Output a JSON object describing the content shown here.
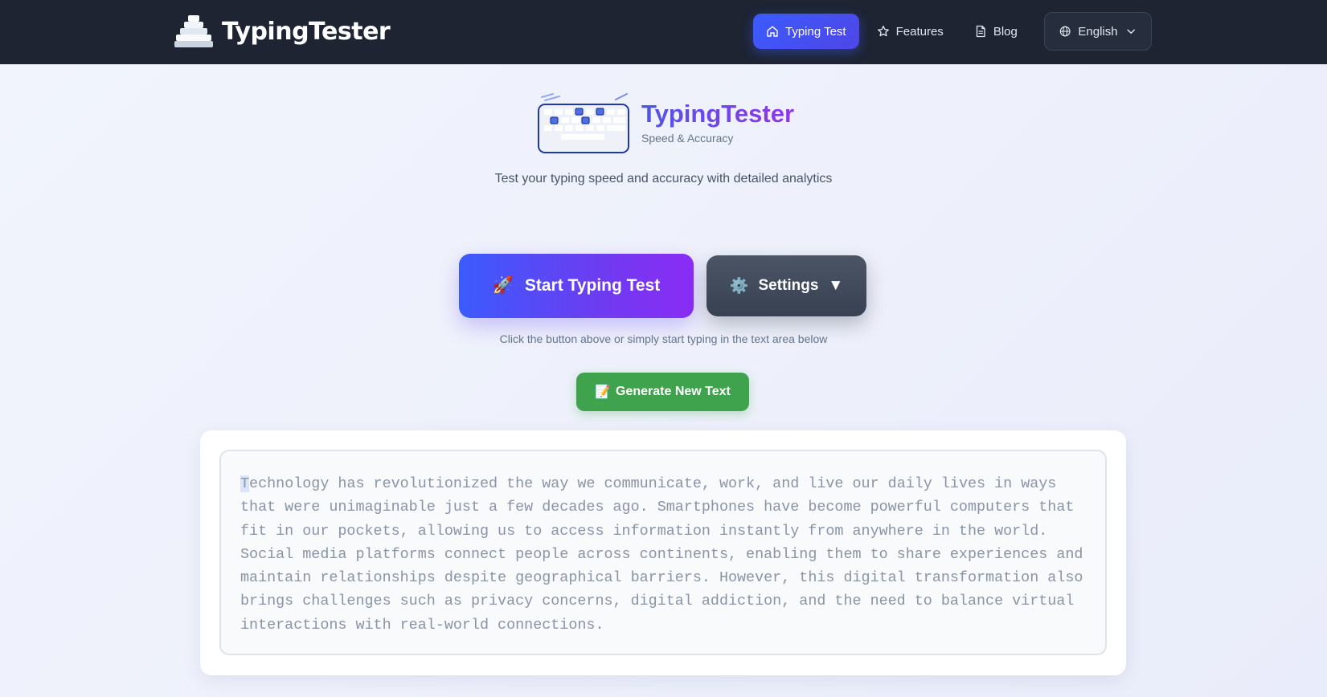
{
  "brand": {
    "name": "TypingTester",
    "logo_icon": "stacked-podium-icon"
  },
  "nav": {
    "items": [
      {
        "label": "Typing Test",
        "icon": "home-icon",
        "active": true
      },
      {
        "label": "Features",
        "icon": "star-icon",
        "active": false
      },
      {
        "label": "Blog",
        "icon": "document-icon",
        "active": false
      }
    ],
    "language": {
      "label": "English",
      "icon": "globe-icon",
      "caret": "chevron-down-icon"
    }
  },
  "hero": {
    "title": "TypingTester",
    "subtitle": "Speed & Accuracy",
    "tagline": "Test your typing speed and accuracy with detailed analytics",
    "logo_icon": "keyboard-icon"
  },
  "actions": {
    "start_icon": "🚀",
    "start_label": "Start Typing Test",
    "settings_icon": "⚙️",
    "settings_label": "Settings",
    "settings_caret": "▼",
    "hint": "Click the button above or simply start typing in the text area below",
    "generate_icon": "📝",
    "generate_label": "Generate New Text"
  },
  "typing": {
    "first_char": "T",
    "rest": "echnology has revolutionized the way we communicate, work, and live our daily lives in ways that were unimaginable just a few decades ago. Smartphones have become powerful computers that fit in our pockets, allowing us to access information instantly from anywhere in the world. Social media platforms connect people across continents, enabling them to share experiences and maintain relationships despite geographical barriers. However, this digital transformation also brings challenges such as privacy concerns, digital addiction, and the need to balance virtual interactions with real-world connections."
  },
  "colors": {
    "nav_bg": "#1e2432",
    "accent_blue": "#3b5bfd",
    "accent_purple": "#8b2cf5",
    "generate_green": "#3fa34d",
    "settings_gray": "#374151"
  }
}
